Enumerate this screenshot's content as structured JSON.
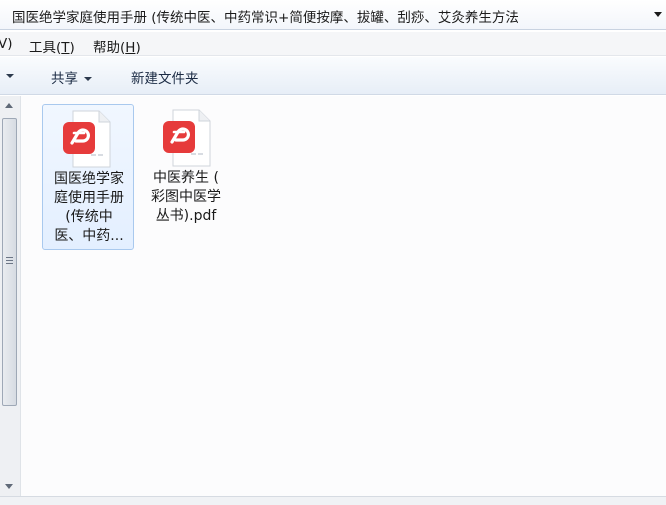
{
  "address": {
    "text": "国医绝学家庭使用手册 (传统中医、中药常识+简便按摩、拔罐、刮痧、艾灸养生方法"
  },
  "menu": {
    "view_fragment": "V)",
    "tools": "工具(",
    "tools_key": "T",
    "tools_close": ")",
    "help": "帮助(",
    "help_key": "H",
    "help_close": ")"
  },
  "toolbar": {
    "share_label": "共享",
    "new_folder_label": "新建文件夹"
  },
  "files": [
    {
      "name_lines": [
        "国医绝学家",
        "庭使用手册",
        "(传统中",
        "医、中药..."
      ],
      "selected": true,
      "icon": "pdf-file-icon"
    },
    {
      "name_lines": [
        "中医养生 (",
        "彩图中医学",
        "丛书).pdf"
      ],
      "selected": false,
      "icon": "pdf-file-icon"
    }
  ],
  "colors": {
    "pdf_badge": "#e63b3b",
    "selection_border": "#a9c9ee"
  }
}
